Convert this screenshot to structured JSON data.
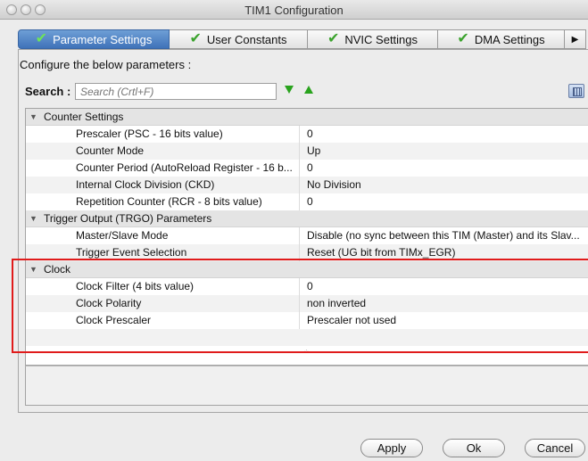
{
  "window": {
    "title": "TIM1 Configuration"
  },
  "tabs": [
    {
      "label": "Parameter Settings",
      "icon": "checkmark-icon"
    },
    {
      "label": "User Constants",
      "icon": "checkmark-icon"
    },
    {
      "label": "NVIC Settings",
      "icon": "checkmark-icon"
    },
    {
      "label": "DMA Settings",
      "icon": "checkmark-icon"
    }
  ],
  "tabs_more_icon": "right-arrow-icon",
  "heading": "Configure the below parameters :",
  "search": {
    "label": "Search :",
    "placeholder": "Search (Crtl+F)"
  },
  "groups": [
    {
      "name": "Counter Settings",
      "params": [
        {
          "name": "Prescaler (PSC - 16 bits value)",
          "value": "0"
        },
        {
          "name": "Counter Mode",
          "value": "Up"
        },
        {
          "name": "Counter Period (AutoReload Register - 16 b...",
          "value": "0"
        },
        {
          "name": "Internal Clock Division (CKD)",
          "value": "No Division"
        },
        {
          "name": "Repetition Counter (RCR - 8 bits value)",
          "value": "0"
        }
      ]
    },
    {
      "name": "Trigger Output (TRGO) Parameters",
      "params": [
        {
          "name": "Master/Slave Mode",
          "value": "Disable (no sync between this TIM (Master) and its Slav..."
        },
        {
          "name": "Trigger Event Selection",
          "value": "Reset (UG bit from TIMx_EGR)"
        }
      ]
    },
    {
      "name": "Clock",
      "params": [
        {
          "name": "Clock Filter (4 bits value)",
          "value": "0"
        },
        {
          "name": "Clock Polarity",
          "value": "non inverted"
        },
        {
          "name": "Clock Prescaler",
          "value": "Prescaler not used"
        }
      ]
    }
  ],
  "buttons": {
    "apply": "Apply",
    "ok": "Ok",
    "cancel": "Cancel"
  },
  "colors": {
    "highlight": "#e01b1b",
    "active_tab": "#4a7cc2",
    "check": "#3ba32d"
  }
}
